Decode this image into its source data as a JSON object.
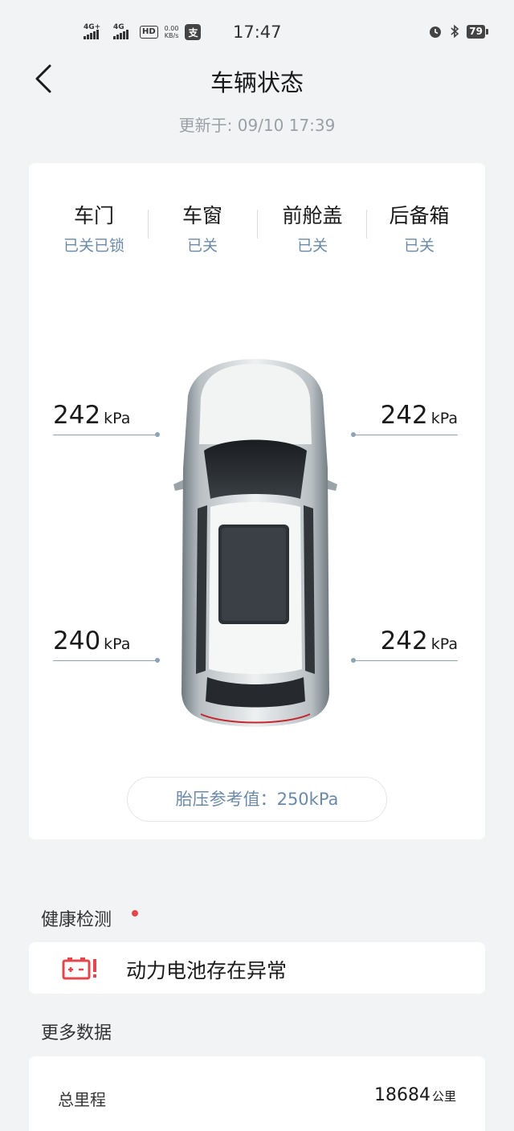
{
  "status_bar": {
    "sig1": "4G+",
    "sig2": "4G",
    "hd": "HD",
    "speed_value": "0.00",
    "speed_unit": "KB/s",
    "pay_glyph": "支",
    "time": "17:47",
    "battery": "79"
  },
  "header": {
    "title": "车辆状态",
    "updated": "更新于: 09/10 17:39"
  },
  "vehicle_status": [
    {
      "label": "车门",
      "value": "已关已锁"
    },
    {
      "label": "车窗",
      "value": "已关"
    },
    {
      "label": "前舱盖",
      "value": "已关"
    },
    {
      "label": "后备箱",
      "value": "已关"
    }
  ],
  "tires": {
    "unit": "kPa",
    "front_left": "242",
    "front_right": "242",
    "rear_left": "240",
    "rear_right": "242"
  },
  "tire_reference": "胎压参考值：250kPa",
  "health": {
    "title": "健康检测",
    "alert": "动力电池存在异常"
  },
  "more_data": {
    "title": "更多数据",
    "mileage_label": "总里程",
    "mileage_value": "18684",
    "mileage_unit": "公里"
  },
  "colors": {
    "accent_blue": "#6b8aa8",
    "alert_red": "#e3474d",
    "background": "#f2f3f5"
  }
}
